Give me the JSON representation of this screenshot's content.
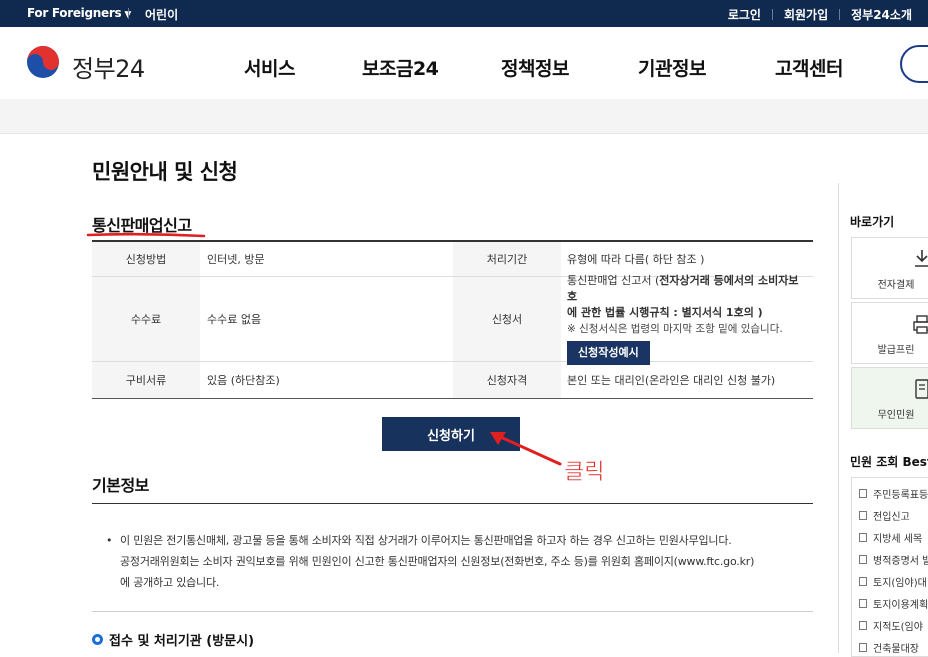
{
  "topbar": {
    "lang": "For Foreigners",
    "kids": "어린이",
    "login": "로그인",
    "signup": "회원가입",
    "about": "정부24소개"
  },
  "header": {
    "logo_text": "정부24",
    "nav": [
      "서비스",
      "보조금24",
      "정책정보",
      "기관정보",
      "고객센터"
    ]
  },
  "page": {
    "title": "민원안내 및 신청",
    "section_title": "통신판매업신고"
  },
  "info": {
    "row1": {
      "h1": "신청방법",
      "v1": "인터넷, 방문",
      "h2": "처리기간",
      "v2": "유형에 따라 다름( 하단 참조 )"
    },
    "row2": {
      "h1": "수수료",
      "v1": "수수료 없음",
      "h2": "신청서",
      "form_line1_a": "통신판매업 신고서 (",
      "form_line1_b": "전자상거래 등에서의 소비자보호",
      "form_line2": "에 관한 법률 시행규칙 : 별지서식 1호의 )",
      "form_note": "※ 신청서식은 법령의 마지막 조항 밑에 있습니다.",
      "form_button": "신청작성예시"
    },
    "row3": {
      "h1": "구비서류",
      "v1": "있음 (하단참조)",
      "h2": "신청자격",
      "v2": "본인 또는 대리인(온라인은 대리인 신청 불가)"
    }
  },
  "apply_button": "신청하기",
  "annotation": {
    "label": "클릭",
    "color": "#e02020"
  },
  "basic": {
    "title": "기본정보",
    "desc_1": "이 민원은 전기통신매체, 광고물 등을 통해 소비자와 직접 상거래가 이루어지는 통신판매업을 하고자 하는 경우 신고하는 민원사무입니다.",
    "desc_2": "공정거래위원회는 소비자 권익보호를 위해 민원인이 신고한 통신판매업자의 신원정보(전화번호, 주소 등)를 위원회 홈페이지(www.ftc.go.kr)",
    "desc_3": "에 공개하고 있습니다.",
    "sub_title": "접수 및 처리기관 (방문시)"
  },
  "sidebar": {
    "title": "바로가기",
    "quick": [
      "전자결제",
      "발급프린",
      "무인민원"
    ],
    "best_title": "민원 조회 Best",
    "best": [
      "주민등록표등",
      "전입신고",
      "지방세 세목",
      "병적증명서 발",
      "토지(임야)대",
      "토지이용계획",
      "지적도(임야",
      "건축물대장"
    ]
  },
  "colors": {
    "topbar": "#10294f",
    "button": "#17325d",
    "accent_blue": "#1b6fd6",
    "red": "#e02020"
  }
}
